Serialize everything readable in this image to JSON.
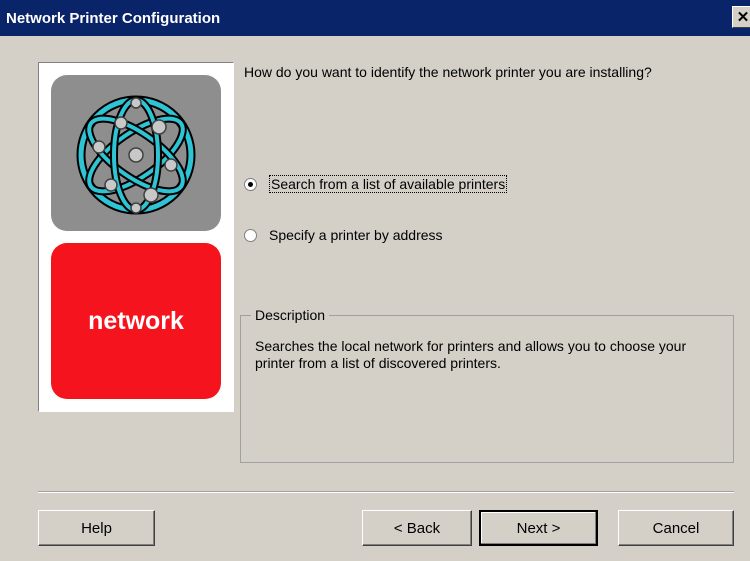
{
  "window": {
    "title": "Network Printer Configuration",
    "close_glyph": "✕"
  },
  "image": {
    "network_label": "network"
  },
  "question": "How do you want to identify the network printer you are installing?",
  "options": [
    {
      "label": "Search from a list of available printers",
      "selected": true,
      "mnemonic": "l"
    },
    {
      "label": "Specify a printer by address",
      "selected": false,
      "mnemonic": "a"
    }
  ],
  "description": {
    "title": "Description",
    "text": "Searches the local network for printers and allows you to choose your printer from a list of discovered printers."
  },
  "buttons": {
    "help": "Help",
    "back": "< Back",
    "next": "Next >",
    "cancel": "Cancel"
  },
  "colors": {
    "titlebar": "#0a246a",
    "network_tile": "#f5141e",
    "globe_tile": "#8e8e8e",
    "globe_ring": "#2ec4d4"
  }
}
